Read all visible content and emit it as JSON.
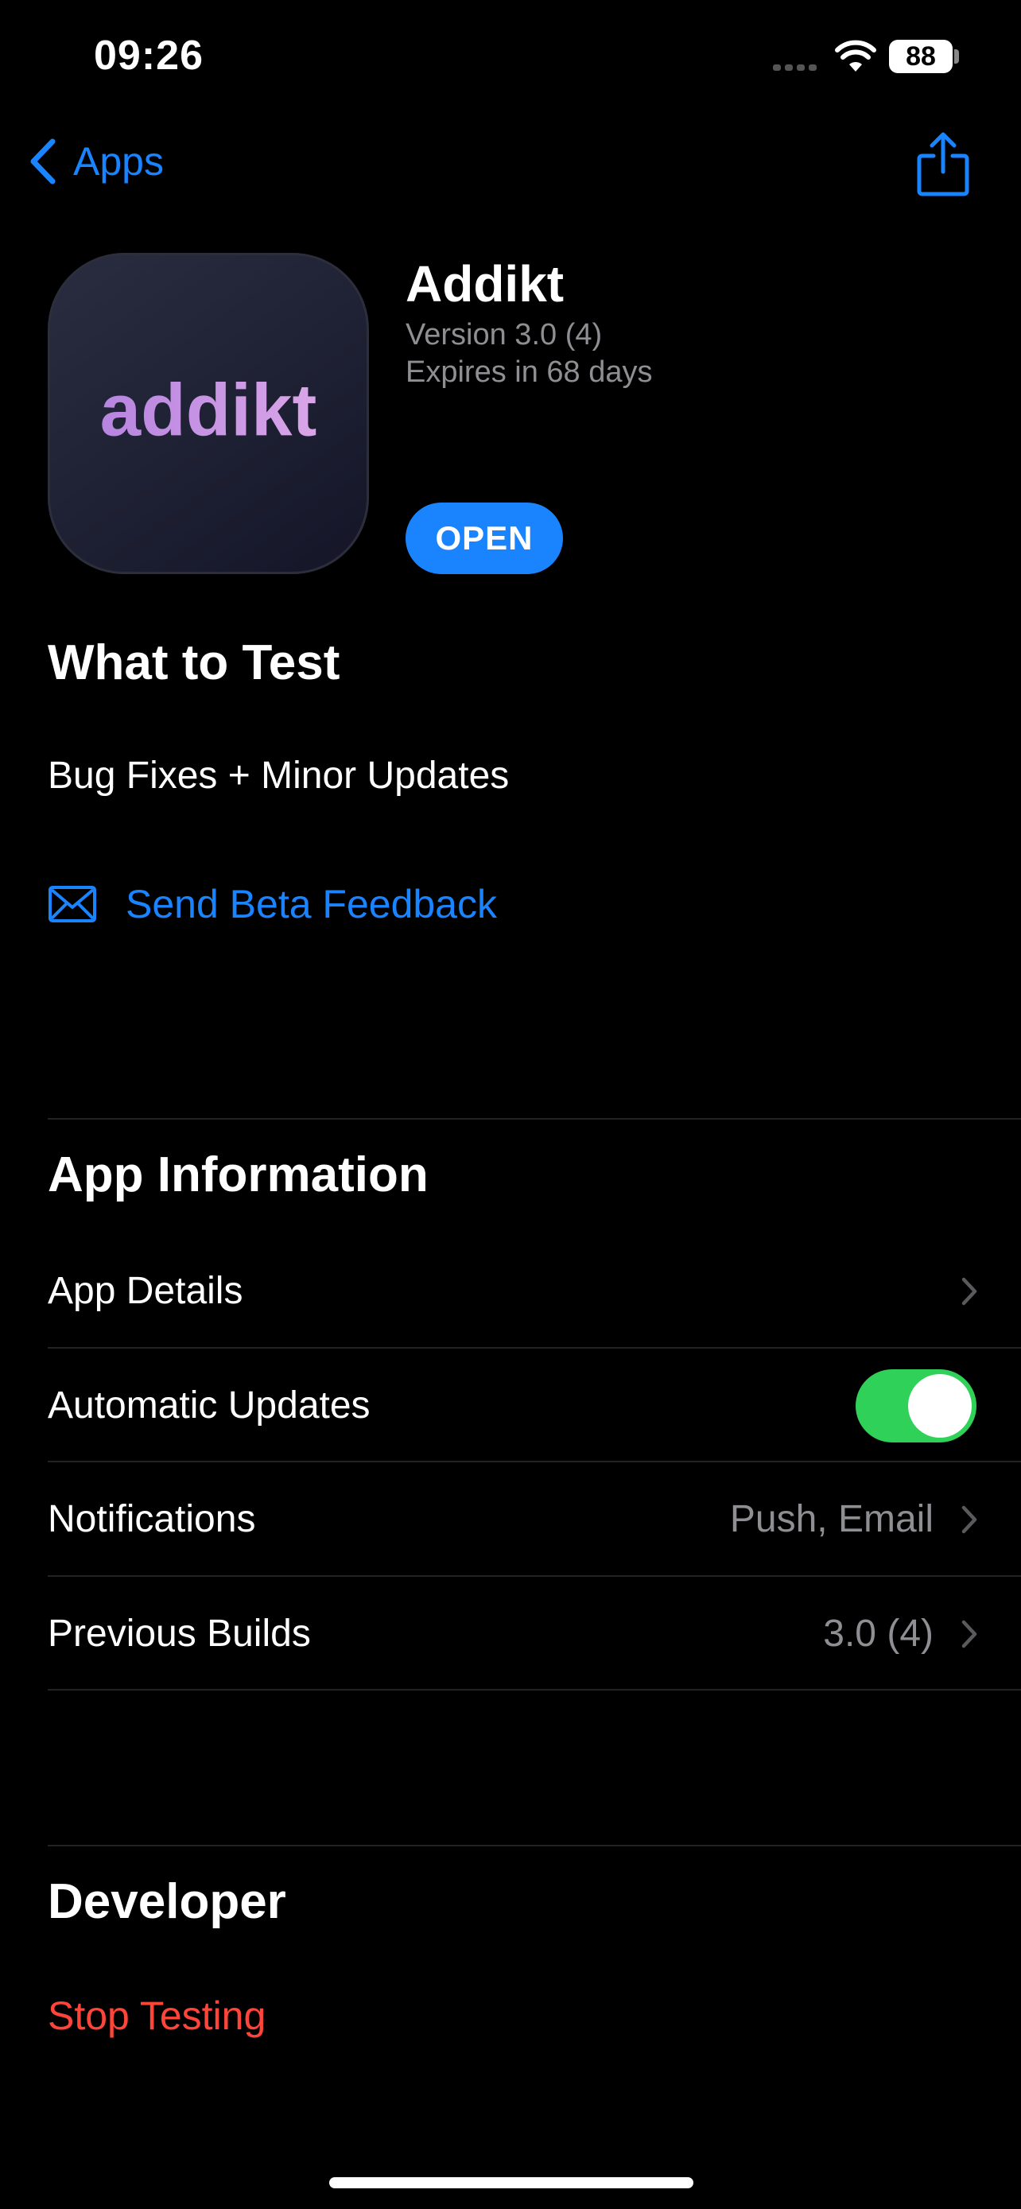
{
  "status_bar": {
    "time": "09:26",
    "battery": "88"
  },
  "nav": {
    "back_label": "Apps"
  },
  "app": {
    "name": "Addikt",
    "version": "Version 3.0 (4)",
    "expiry": "Expires in 68 days",
    "open_label": "OPEN",
    "logo_text": "addikt"
  },
  "what_to_test": {
    "title": "What to Test",
    "notes": "Bug Fixes + Minor Updates",
    "feedback_label": "Send Beta Feedback"
  },
  "app_information": {
    "title": "App Information",
    "rows": [
      {
        "label": "App Details",
        "value": ""
      },
      {
        "label": "Automatic Updates",
        "toggle": true
      },
      {
        "label": "Notifications",
        "value": "Push, Email"
      },
      {
        "label": "Previous Builds",
        "value": "3.0 (4)"
      }
    ]
  },
  "developer": {
    "title": "Developer",
    "stop_label": "Stop Testing"
  },
  "colors": {
    "accent": "#1a84ff",
    "toggle_on": "#30d158",
    "destructive": "#ff453a",
    "secondary_text": "#8e8e93"
  }
}
